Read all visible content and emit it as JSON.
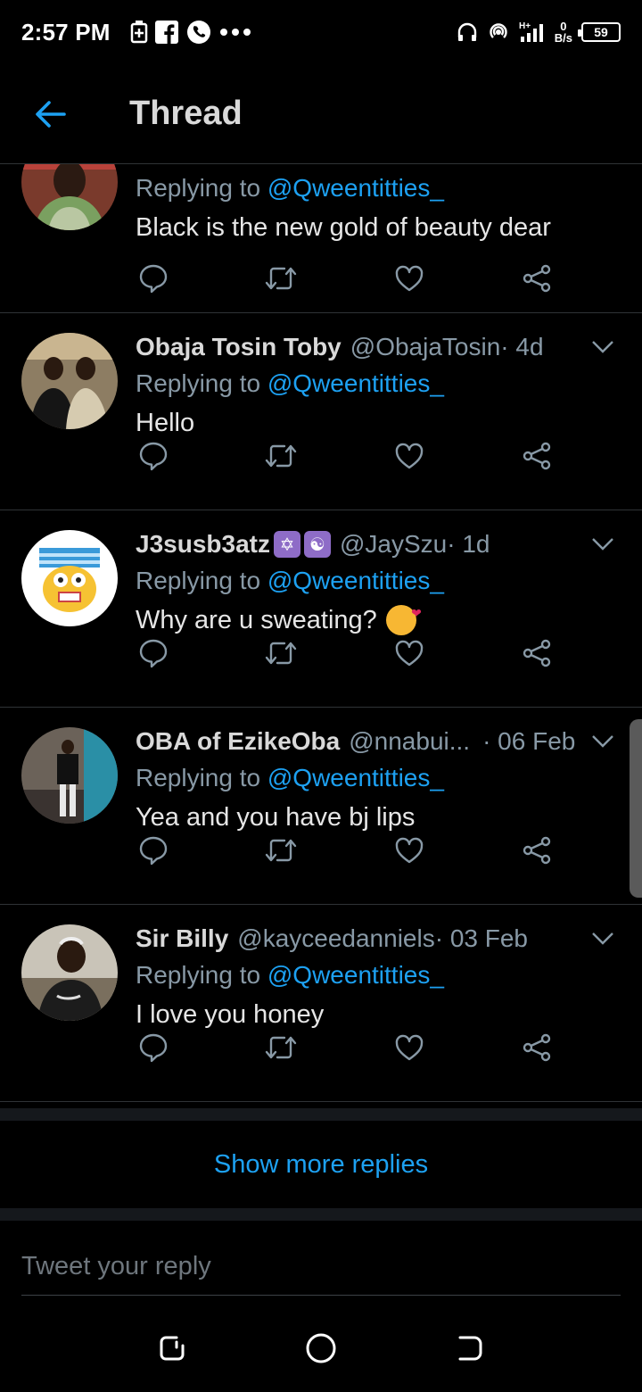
{
  "status_bar": {
    "time": "2:57 PM",
    "net_speed_value": "0",
    "net_speed_unit": "B/s",
    "network_type": "H+",
    "battery": "59"
  },
  "header": {
    "title": "Thread"
  },
  "tweets": [
    {
      "name": "",
      "handle": "",
      "date": "",
      "replying_label": "Replying to ",
      "replying_to": "@Qweentitties_",
      "text": "Black is the new gold of beauty dear"
    },
    {
      "name": "Obaja Tosin Toby",
      "handle": "@ObajaTosin",
      "date": " · 4d",
      "replying_label": "Replying to ",
      "replying_to": "@Qweentitties_",
      "text": "Hello"
    },
    {
      "name": "J3susb3atz",
      "handle": "@JaySzu",
      "date": " · 1d",
      "replying_label": "Replying to ",
      "replying_to": "@Qweentitties_",
      "text": "Why are u sweating?"
    },
    {
      "name": "OBA of EzikeOba",
      "handle": "@nnabui...",
      "date": " · 06 Feb",
      "replying_label": "Replying to ",
      "replying_to": "@Qweentitties_",
      "text": "Yea and you have bj lips"
    },
    {
      "name": "Sir Billy",
      "handle": "@kayceedanniels",
      "date": " · 03 Feb",
      "replying_label": "Replying to ",
      "replying_to": "@Qweentitties_",
      "text": "I love you honey"
    }
  ],
  "show_more": "Show more replies",
  "compose": {
    "placeholder": "Tweet your reply"
  },
  "colors": {
    "accent": "#1da1f2",
    "background": "#000000",
    "secondary_text": "#8899a6"
  },
  "icons": [
    "back-arrow-icon",
    "reply-icon",
    "retweet-icon",
    "like-icon",
    "share-icon",
    "chevron-down-icon"
  ]
}
